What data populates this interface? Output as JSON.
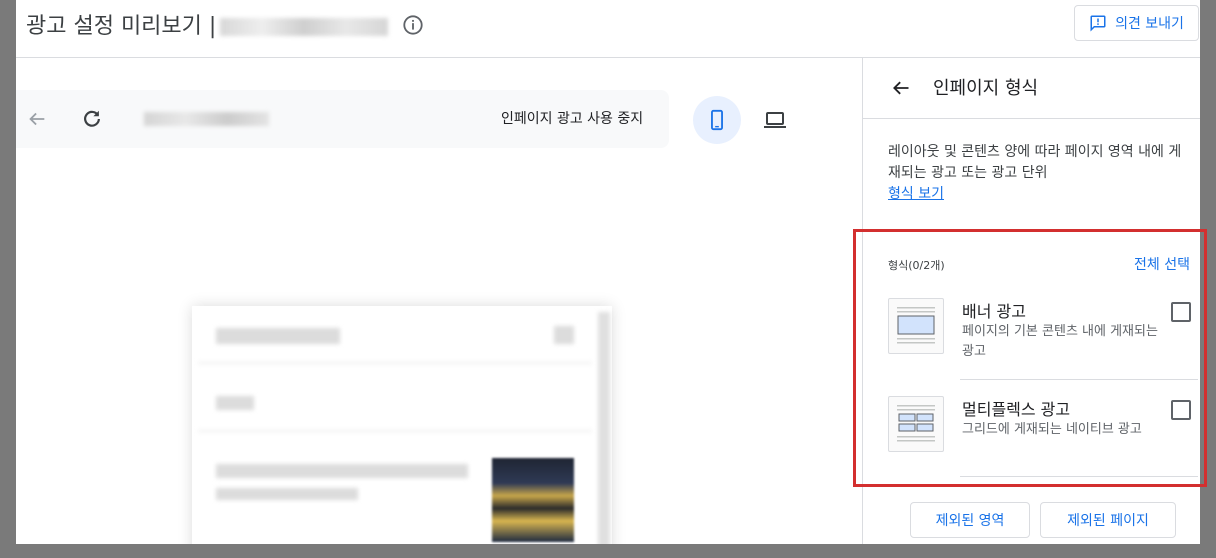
{
  "header": {
    "title": "광고 설정 미리보기 |",
    "info_icon": "info-icon",
    "feedback_label": "의견 보내기",
    "feedback_icon": "feedback-icon"
  },
  "preview": {
    "back_icon": "arrow-back-icon",
    "reload_icon": "reload-icon",
    "disable_inpage_label": "인페이지 광고 사용 중지",
    "devices": [
      {
        "icon": "smartphone-icon",
        "selected": true
      },
      {
        "icon": "laptop-icon",
        "selected": false
      }
    ]
  },
  "panel": {
    "back_icon": "arrow-back-icon",
    "title": "인페이지 형식",
    "description": "레이아웃 및 콘텐츠 양에 따라 페이지 영역 내에 게재되는 광고 또는 광고 단위",
    "view_formats_link": "형식 보기",
    "section_label": "형식(0/2개)",
    "select_all": "전체 선택",
    "formats": [
      {
        "name": "배너 광고",
        "description": "페이지의 기본 콘텐츠 내에 게재되는 광고",
        "checked": false
      },
      {
        "name": "멀티플렉스 광고",
        "description": "그리드에 게재되는 네이티브 광고",
        "checked": false
      }
    ],
    "excluded_areas_label": "제외된 영역",
    "excluded_pages_label": "제외된 페이지"
  },
  "colors": {
    "accent": "#1a73e8",
    "highlight_border": "#d32f2f",
    "selected_device_bg": "#e8f0fe"
  }
}
